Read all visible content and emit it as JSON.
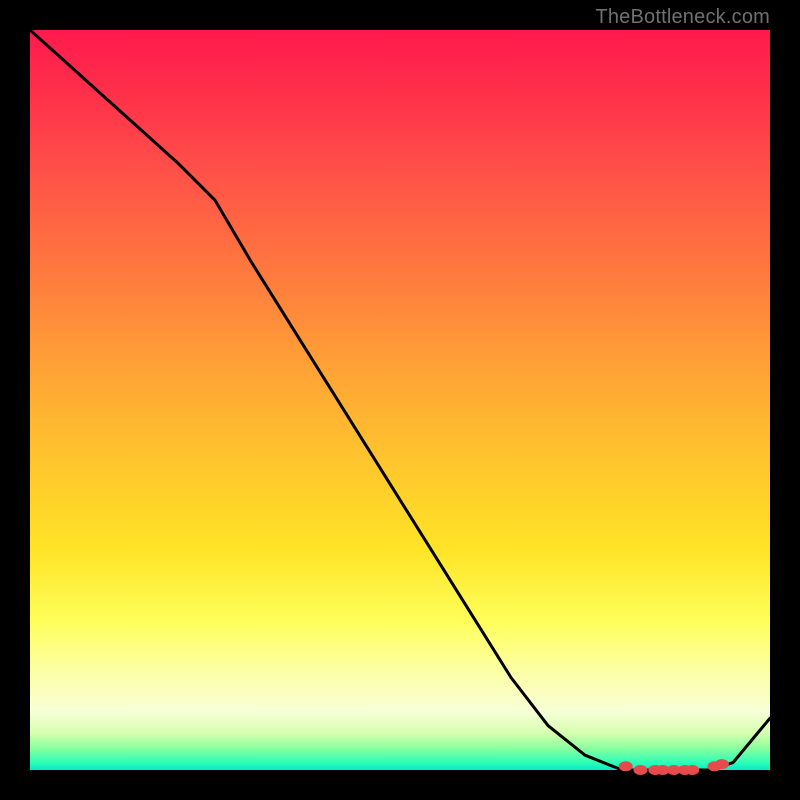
{
  "attribution": "TheBottleneck.com",
  "chart_data": {
    "type": "line",
    "title": "",
    "xlabel": "",
    "ylabel": "",
    "xlim": [
      0,
      1
    ],
    "ylim": [
      0,
      1
    ],
    "x": [
      0.0,
      0.05,
      0.1,
      0.15,
      0.2,
      0.25,
      0.3,
      0.35,
      0.4,
      0.45,
      0.5,
      0.55,
      0.6,
      0.65,
      0.7,
      0.75,
      0.8,
      0.83,
      0.86,
      0.89,
      0.92,
      0.95,
      1.0
    ],
    "values": [
      1.0,
      0.955,
      0.91,
      0.865,
      0.82,
      0.77,
      0.685,
      0.605,
      0.525,
      0.445,
      0.365,
      0.285,
      0.205,
      0.125,
      0.06,
      0.02,
      0.0,
      0.0,
      0.0,
      0.0,
      0.0,
      0.01,
      0.07
    ],
    "valley_markers_x": [
      0.805,
      0.825,
      0.845,
      0.855,
      0.87,
      0.885,
      0.895,
      0.925,
      0.935
    ],
    "valley_markers_y": [
      0.005,
      0.0,
      0.0,
      0.0,
      0.0,
      0.0,
      0.0,
      0.005,
      0.008
    ],
    "background_gradient_stops": [
      {
        "pos": 0.0,
        "color": "#ff1a4d"
      },
      {
        "pos": 0.33,
        "color": "#ff7a3e"
      },
      {
        "pos": 0.7,
        "color": "#ffe326"
      },
      {
        "pos": 0.92,
        "color": "#f7ffd7"
      },
      {
        "pos": 1.0,
        "color": "#09e7c5"
      }
    ]
  }
}
